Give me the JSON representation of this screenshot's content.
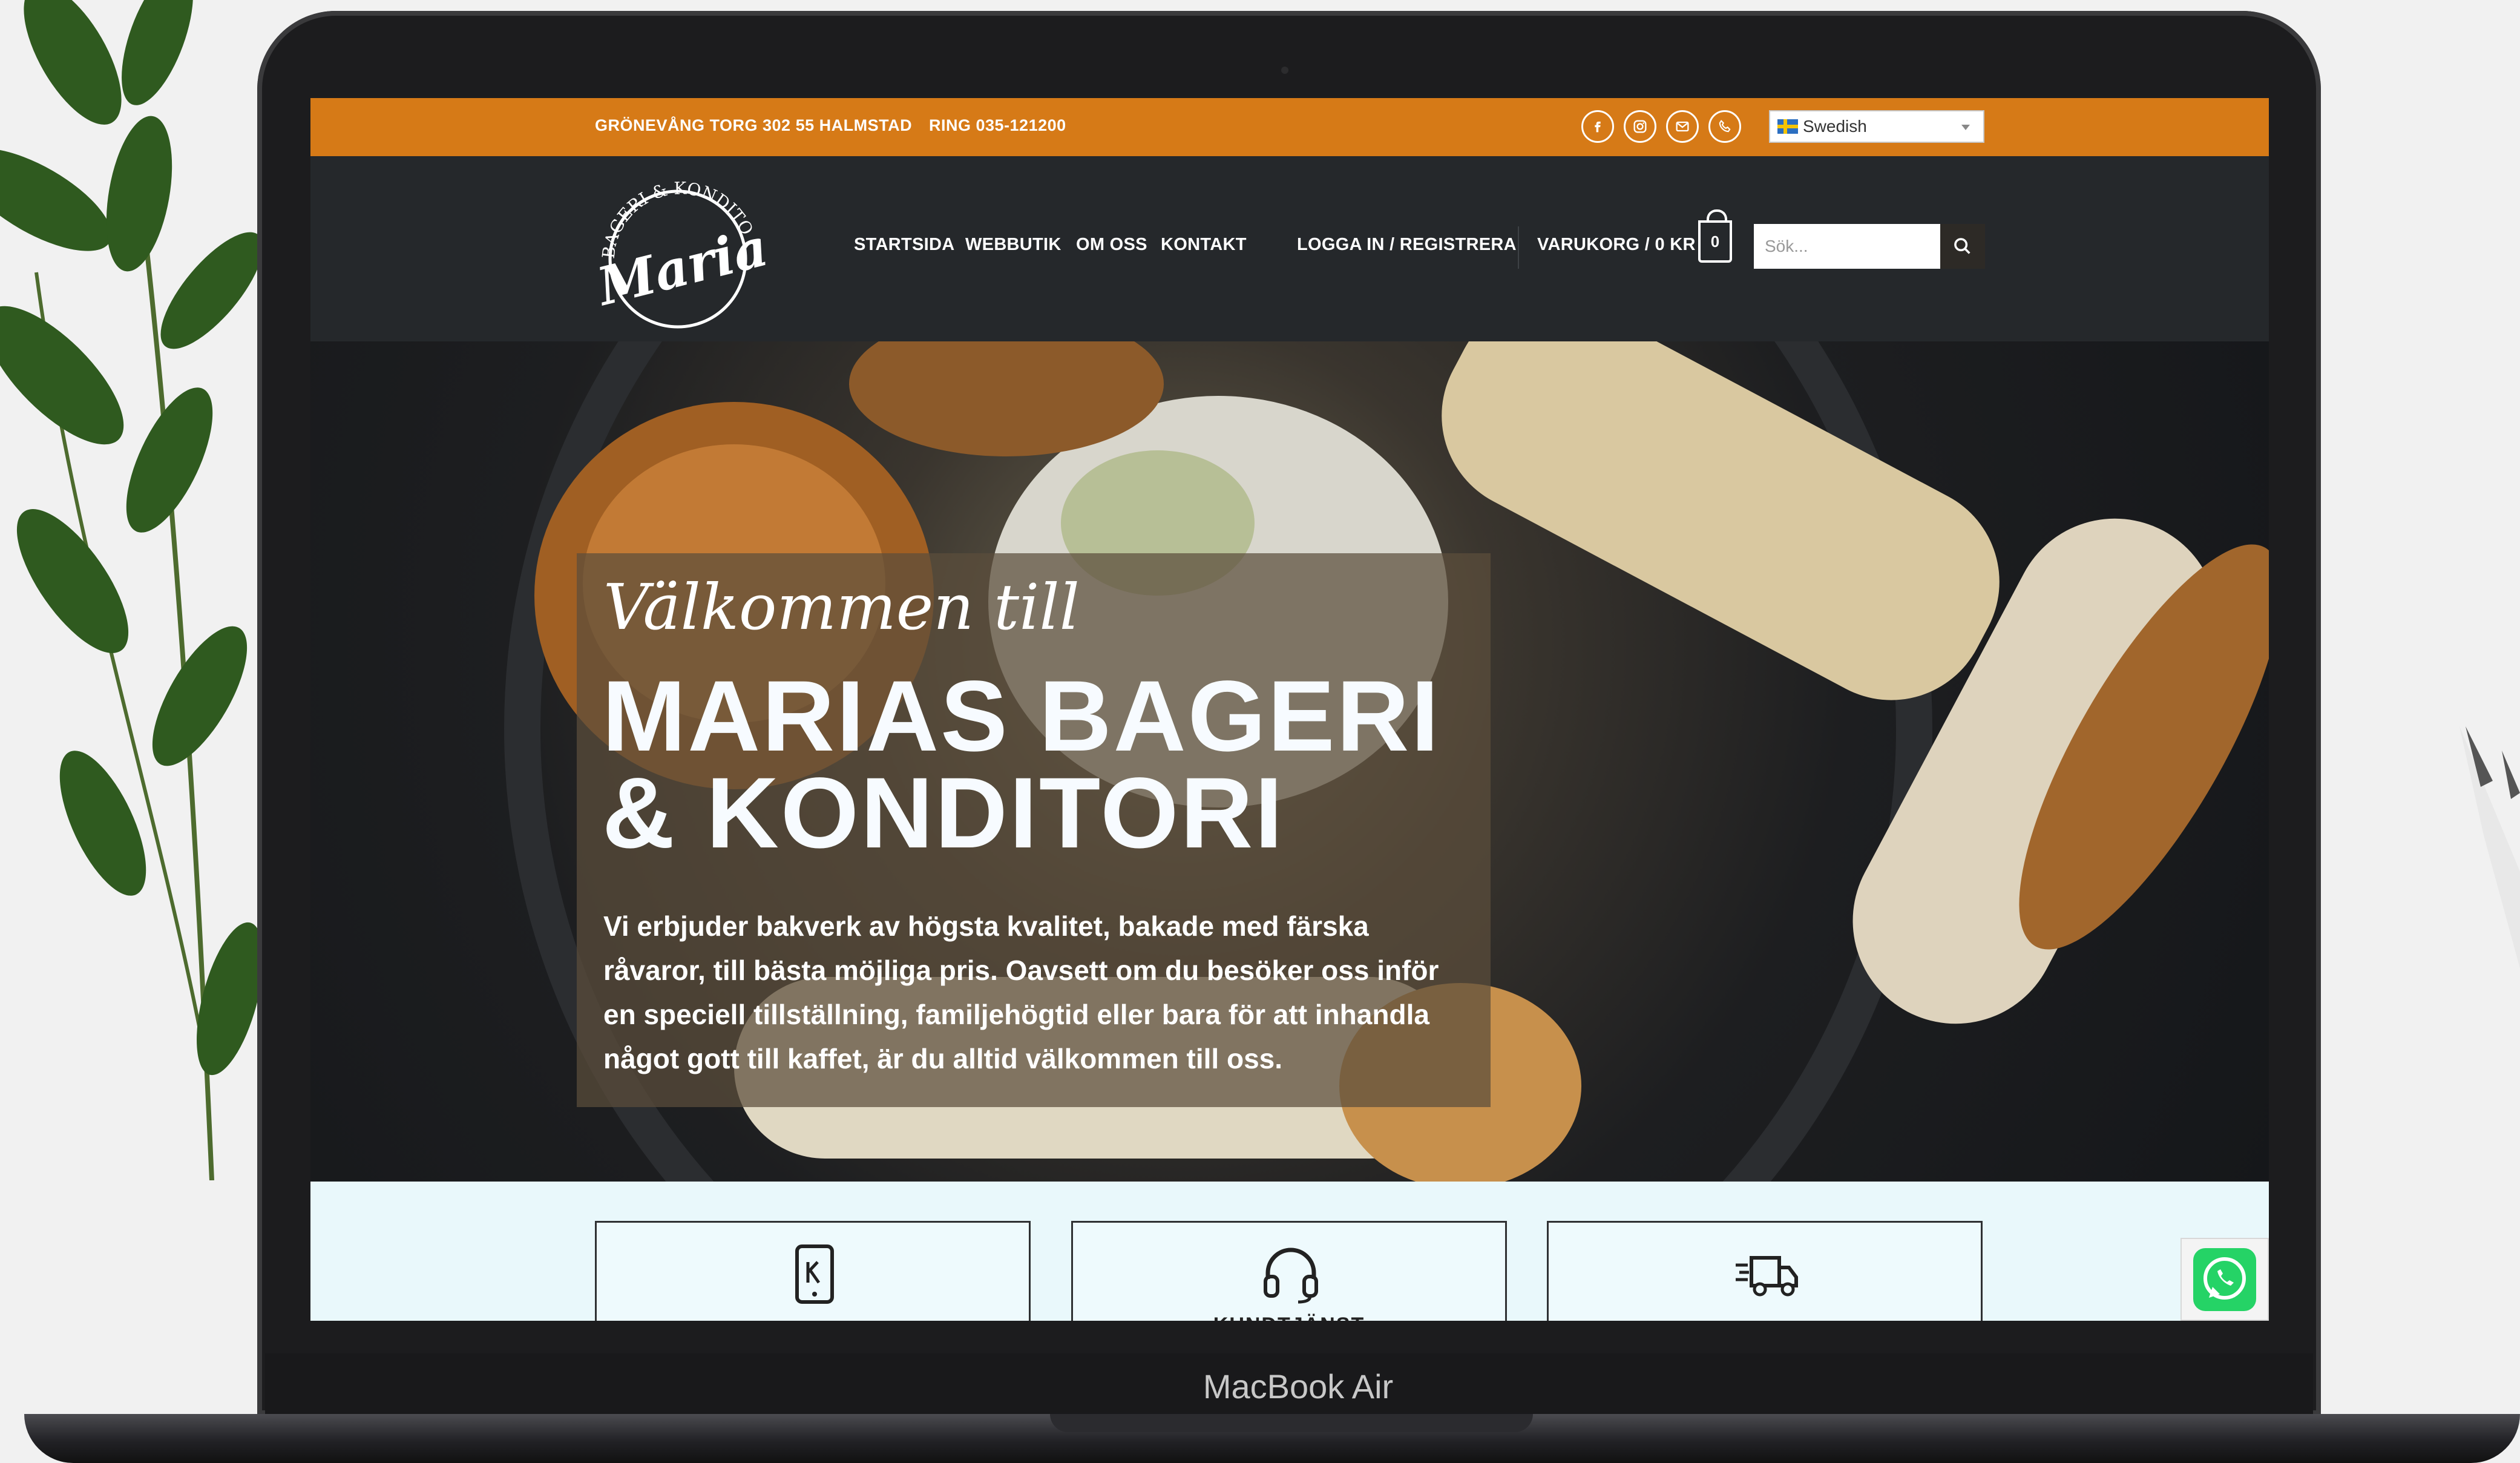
{
  "device": {
    "brand": "MacBook Air"
  },
  "topbar": {
    "address": "GRÖNEVÅNG TORG 302 55 HALMSTAD",
    "phone": "RING 035-121200",
    "social_icons": [
      "facebook-icon",
      "instagram-icon",
      "mail-icon",
      "phone-icon"
    ],
    "language": "Swedish",
    "bg_color": "#d67a17"
  },
  "header": {
    "logo": {
      "top_text": "BAGERI & KONDITORI",
      "name": "Maria's"
    },
    "nav": [
      "STARTSIDA",
      "WEBBUTIK",
      "OM OSS",
      "KONTAKT"
    ],
    "login": "LOGGA IN / REGISTRERA",
    "cart": "VARUKORG / 0 KR",
    "cart_count": "0",
    "search_placeholder": "Sök...",
    "bg_color": "#25282b"
  },
  "hero": {
    "script": "Välkommen till",
    "title": "MARIAS BAGERI & KONDITORI",
    "body": "Vi erbjuder bakverk av högsta kvalitet, bakade med färska råvaror, till bästa möjliga pris. Oavsett om du besöker oss inför en speciell tillställning, familjehögtid eller bara för att inhandla något gott till kaffet, är du alltid välkommen till oss."
  },
  "features": [
    {
      "icon": "mobile-payment-icon",
      "label": ""
    },
    {
      "icon": "headset-icon",
      "label": "KUNDTJÄNST"
    },
    {
      "icon": "delivery-truck-icon",
      "label": ""
    }
  ],
  "whatsapp": {
    "icon": "whatsapp-icon",
    "color": "#25d366"
  }
}
